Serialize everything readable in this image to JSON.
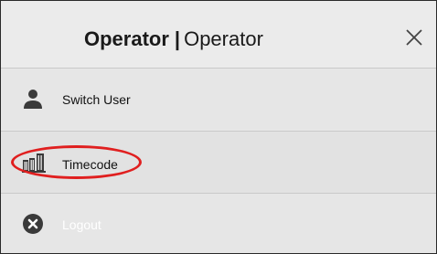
{
  "header": {
    "title_bold": "Operator",
    "separator": "|",
    "title_regular": "Operator",
    "close_icon": "close-icon"
  },
  "menu": {
    "items": [
      {
        "label": "Switch User",
        "icon": "user-icon"
      },
      {
        "label": "Timecode",
        "icon": "timecode-icon"
      },
      {
        "label": "Logout",
        "icon": "logout-icon"
      }
    ]
  },
  "colors": {
    "highlight": "#e01f1f",
    "panel_bg": "#e8e8e8",
    "icon": "#3a3a3a"
  }
}
